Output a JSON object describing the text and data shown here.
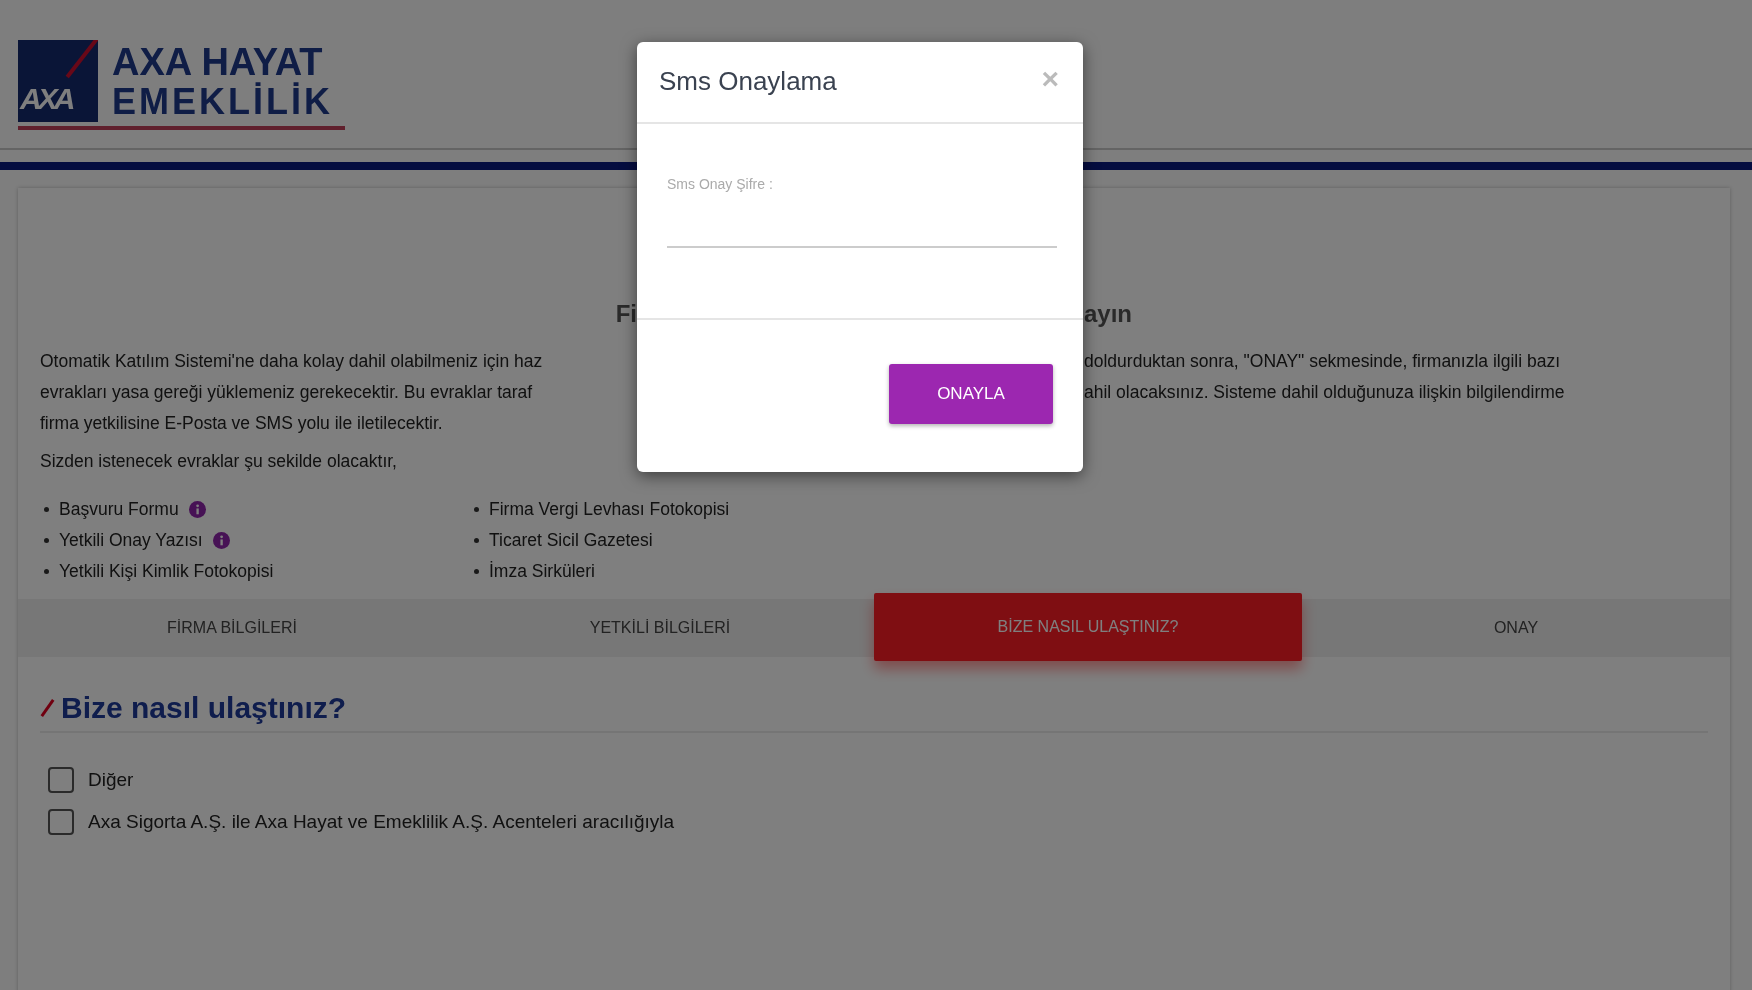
{
  "logo": {
    "mark": "AXA",
    "lines": [
      "AXA HAYAT",
      "EMEKLİLİK"
    ]
  },
  "page_title": {
    "left": "Fi",
    "right": "ayın"
  },
  "intro_lines": [
    {
      "left": "Otomatik Katılım Sistemi'ne daha kolay dahil olabilmeniz için haz",
      "right": "doldurduktan sonra, \"ONAY\" sekmesinde, firmanızla ilgili bazı"
    },
    {
      "left": "evrakları yasa gereği yüklemeniz gerekecektir. Bu evraklar taraf",
      "right": "ahil olacaksınız. Sisteme dahil olduğunuza ilişkin bilgilendirme"
    },
    {
      "left": "firma yetkilisine E-Posta ve SMS yolu ile iletilecektir."
    }
  ],
  "documents_intro": "Sizden istenecek evraklar şu sekilde olacaktır,",
  "documents": [
    {
      "label": "Başvuru Formu",
      "info": true
    },
    {
      "label": "Yetkili Onay Yazısı",
      "info": true
    },
    {
      "label": "Yetkili Kişi Kimlik Fotokopisi",
      "info": false
    },
    {
      "label": "Firma Vergi Levhası Fotokopisi",
      "info": false
    },
    {
      "label": "Ticaret Sicil Gazetesi",
      "info": false
    },
    {
      "label": "İmza Sirküleri",
      "info": false
    }
  ],
  "tabs": [
    {
      "label": "FİRMA BİLGİLERİ",
      "selected": false
    },
    {
      "label": "YETKİLİ BİLGİLERİ",
      "selected": false
    },
    {
      "label": "BİZE NASIL ULAŞTINIZ?",
      "selected": true
    },
    {
      "label": "ONAY",
      "selected": false
    }
  ],
  "section": {
    "title": "Bize nasıl ulaştınız?",
    "options": [
      {
        "label": "Diğer",
        "checked": false
      },
      {
        "label": "Axa Sigorta A.Ş. ile Axa Hayat ve Emeklilik A.Ş. Acenteleri aracılığıyla",
        "checked": false
      }
    ]
  },
  "modal": {
    "title": "Sms Onaylama",
    "close": "×",
    "field_label": "Sms Onay Şifre :",
    "button": "ONAYLA"
  }
}
